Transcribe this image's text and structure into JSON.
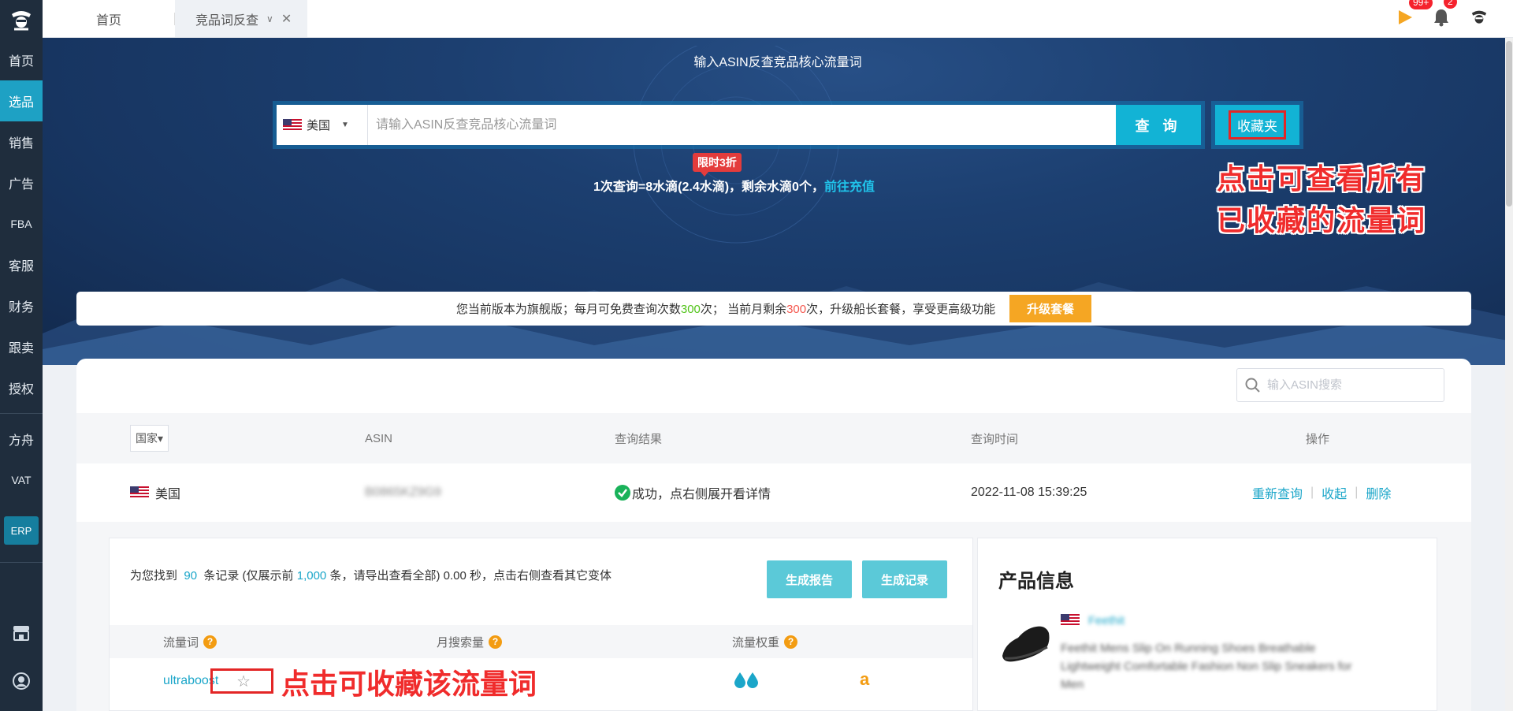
{
  "sidebar": {
    "items": [
      {
        "label": "首页"
      },
      {
        "label": "选品"
      },
      {
        "label": "销售"
      },
      {
        "label": "广告"
      },
      {
        "label": "FBA"
      },
      {
        "label": "客服"
      },
      {
        "label": "财务"
      },
      {
        "label": "跟卖"
      },
      {
        "label": "授权"
      },
      {
        "label": "方舟"
      },
      {
        "label": "VAT"
      }
    ],
    "erp_label": "ERP",
    "active_index": 1
  },
  "tabs": {
    "home_label": "首页",
    "active_label": "竞品词反查"
  },
  "notifications": {
    "flag_badge": "99+",
    "bell_badge": "2"
  },
  "hero": {
    "title": "输入ASIN反查竞品核心流量词",
    "country_selected": "美国",
    "search_placeholder": "请输入ASIN反查竞品核心流量词",
    "query_button": "查 询",
    "favorites_button": "收藏夹",
    "promo_badge": "限时3折",
    "cost_text": "1次查询=8水滴(2.4水滴)，剩余水滴0个，",
    "recharge_link": "前往充值",
    "annotation_line1": "点击可查看所有",
    "annotation_line2": "已收藏的流量词"
  },
  "version_bar": {
    "text_a": "您当前版本为旗舰版；每月可免费查询次数",
    "free_count": "300",
    "text_b": "次；   当前月剩余",
    "remaining": "300",
    "text_c": "次，升级船长套餐，享受更高级功能",
    "upgrade_button": "升级套餐"
  },
  "history": {
    "search_placeholder": "输入ASIN搜索",
    "columns": {
      "country": "国家",
      "asin": "ASIN",
      "result": "查询结果",
      "time": "查询时间",
      "ops": "操作"
    },
    "row": {
      "country": "美国",
      "asin": "B0865KZ9G9",
      "result": "成功，点右侧展开看详情",
      "time": "2022-11-08 15:39:25",
      "op_requery": "重新查询",
      "op_collapse": "收起",
      "op_delete": "删除"
    }
  },
  "detail": {
    "records_prefix": "为您找到",
    "records_count": "90",
    "records_mid": "条记录 (仅展示前",
    "records_limit": "1,000",
    "records_suffix": "条，请导出查看全部) 0.00 秒，点击右侧查看其它变体",
    "report_button": "生成报告",
    "log_button": "生成记录",
    "col_keyword": "流量词",
    "col_volume": "月搜索量",
    "col_weight": "流量权重",
    "keyword": "ultraboost",
    "annotation": "点击可收藏该流量词"
  },
  "product": {
    "title": "产品信息",
    "brand": "Feethit",
    "description": "Feethit Mens Slip On Running Shoes Breathable Lightweight Comfortable Fashion Non Slip Sneakers for Men"
  },
  "colors": {
    "sidebar_bg": "#1f2d3d",
    "accent": "#12b3d5",
    "annotation_red": "#f02c2c",
    "upgrade_orange": "#f5a623"
  }
}
